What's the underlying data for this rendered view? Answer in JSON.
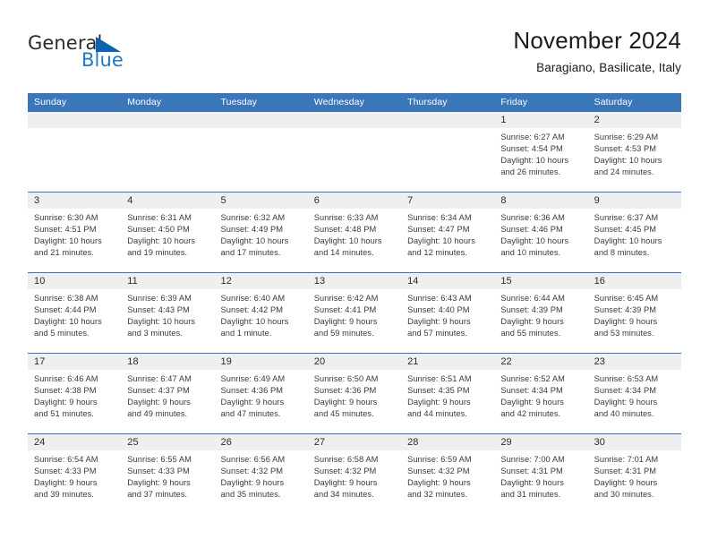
{
  "logo": {
    "word_one": "General",
    "word_two": "Blue",
    "triangle_color": "#0b62ad",
    "blue_text_color": "#1f7ac9"
  },
  "header": {
    "title": "November 2024",
    "subtitle": "Baragiano, Basilicate, Italy"
  },
  "theme": {
    "header_blue": "#3a77b9",
    "daynum_gray": "#efeff0",
    "text_dark": "#2b2b2b",
    "body_text": "#3a3a3a"
  },
  "weekdays": [
    "Sunday",
    "Monday",
    "Tuesday",
    "Wednesday",
    "Thursday",
    "Friday",
    "Saturday"
  ],
  "weeks": [
    [
      {
        "day": "",
        "empty": true
      },
      {
        "day": "",
        "empty": true
      },
      {
        "day": "",
        "empty": true
      },
      {
        "day": "",
        "empty": true
      },
      {
        "day": "",
        "empty": true
      },
      {
        "day": "1",
        "sunrise": "Sunrise: 6:27 AM",
        "sunset": "Sunset: 4:54 PM",
        "daylight_1": "Daylight: 10 hours",
        "daylight_2": "and 26 minutes."
      },
      {
        "day": "2",
        "sunrise": "Sunrise: 6:29 AM",
        "sunset": "Sunset: 4:53 PM",
        "daylight_1": "Daylight: 10 hours",
        "daylight_2": "and 24 minutes."
      }
    ],
    [
      {
        "day": "3",
        "sunrise": "Sunrise: 6:30 AM",
        "sunset": "Sunset: 4:51 PM",
        "daylight_1": "Daylight: 10 hours",
        "daylight_2": "and 21 minutes."
      },
      {
        "day": "4",
        "sunrise": "Sunrise: 6:31 AM",
        "sunset": "Sunset: 4:50 PM",
        "daylight_1": "Daylight: 10 hours",
        "daylight_2": "and 19 minutes."
      },
      {
        "day": "5",
        "sunrise": "Sunrise: 6:32 AM",
        "sunset": "Sunset: 4:49 PM",
        "daylight_1": "Daylight: 10 hours",
        "daylight_2": "and 17 minutes."
      },
      {
        "day": "6",
        "sunrise": "Sunrise: 6:33 AM",
        "sunset": "Sunset: 4:48 PM",
        "daylight_1": "Daylight: 10 hours",
        "daylight_2": "and 14 minutes."
      },
      {
        "day": "7",
        "sunrise": "Sunrise: 6:34 AM",
        "sunset": "Sunset: 4:47 PM",
        "daylight_1": "Daylight: 10 hours",
        "daylight_2": "and 12 minutes."
      },
      {
        "day": "8",
        "sunrise": "Sunrise: 6:36 AM",
        "sunset": "Sunset: 4:46 PM",
        "daylight_1": "Daylight: 10 hours",
        "daylight_2": "and 10 minutes."
      },
      {
        "day": "9",
        "sunrise": "Sunrise: 6:37 AM",
        "sunset": "Sunset: 4:45 PM",
        "daylight_1": "Daylight: 10 hours",
        "daylight_2": "and 8 minutes."
      }
    ],
    [
      {
        "day": "10",
        "sunrise": "Sunrise: 6:38 AM",
        "sunset": "Sunset: 4:44 PM",
        "daylight_1": "Daylight: 10 hours",
        "daylight_2": "and 5 minutes."
      },
      {
        "day": "11",
        "sunrise": "Sunrise: 6:39 AM",
        "sunset": "Sunset: 4:43 PM",
        "daylight_1": "Daylight: 10 hours",
        "daylight_2": "and 3 minutes."
      },
      {
        "day": "12",
        "sunrise": "Sunrise: 6:40 AM",
        "sunset": "Sunset: 4:42 PM",
        "daylight_1": "Daylight: 10 hours",
        "daylight_2": "and 1 minute."
      },
      {
        "day": "13",
        "sunrise": "Sunrise: 6:42 AM",
        "sunset": "Sunset: 4:41 PM",
        "daylight_1": "Daylight: 9 hours",
        "daylight_2": "and 59 minutes."
      },
      {
        "day": "14",
        "sunrise": "Sunrise: 6:43 AM",
        "sunset": "Sunset: 4:40 PM",
        "daylight_1": "Daylight: 9 hours",
        "daylight_2": "and 57 minutes."
      },
      {
        "day": "15",
        "sunrise": "Sunrise: 6:44 AM",
        "sunset": "Sunset: 4:39 PM",
        "daylight_1": "Daylight: 9 hours",
        "daylight_2": "and 55 minutes."
      },
      {
        "day": "16",
        "sunrise": "Sunrise: 6:45 AM",
        "sunset": "Sunset: 4:39 PM",
        "daylight_1": "Daylight: 9 hours",
        "daylight_2": "and 53 minutes."
      }
    ],
    [
      {
        "day": "17",
        "sunrise": "Sunrise: 6:46 AM",
        "sunset": "Sunset: 4:38 PM",
        "daylight_1": "Daylight: 9 hours",
        "daylight_2": "and 51 minutes."
      },
      {
        "day": "18",
        "sunrise": "Sunrise: 6:47 AM",
        "sunset": "Sunset: 4:37 PM",
        "daylight_1": "Daylight: 9 hours",
        "daylight_2": "and 49 minutes."
      },
      {
        "day": "19",
        "sunrise": "Sunrise: 6:49 AM",
        "sunset": "Sunset: 4:36 PM",
        "daylight_1": "Daylight: 9 hours",
        "daylight_2": "and 47 minutes."
      },
      {
        "day": "20",
        "sunrise": "Sunrise: 6:50 AM",
        "sunset": "Sunset: 4:36 PM",
        "daylight_1": "Daylight: 9 hours",
        "daylight_2": "and 45 minutes."
      },
      {
        "day": "21",
        "sunrise": "Sunrise: 6:51 AM",
        "sunset": "Sunset: 4:35 PM",
        "daylight_1": "Daylight: 9 hours",
        "daylight_2": "and 44 minutes."
      },
      {
        "day": "22",
        "sunrise": "Sunrise: 6:52 AM",
        "sunset": "Sunset: 4:34 PM",
        "daylight_1": "Daylight: 9 hours",
        "daylight_2": "and 42 minutes."
      },
      {
        "day": "23",
        "sunrise": "Sunrise: 6:53 AM",
        "sunset": "Sunset: 4:34 PM",
        "daylight_1": "Daylight: 9 hours",
        "daylight_2": "and 40 minutes."
      }
    ],
    [
      {
        "day": "24",
        "sunrise": "Sunrise: 6:54 AM",
        "sunset": "Sunset: 4:33 PM",
        "daylight_1": "Daylight: 9 hours",
        "daylight_2": "and 39 minutes."
      },
      {
        "day": "25",
        "sunrise": "Sunrise: 6:55 AM",
        "sunset": "Sunset: 4:33 PM",
        "daylight_1": "Daylight: 9 hours",
        "daylight_2": "and 37 minutes."
      },
      {
        "day": "26",
        "sunrise": "Sunrise: 6:56 AM",
        "sunset": "Sunset: 4:32 PM",
        "daylight_1": "Daylight: 9 hours",
        "daylight_2": "and 35 minutes."
      },
      {
        "day": "27",
        "sunrise": "Sunrise: 6:58 AM",
        "sunset": "Sunset: 4:32 PM",
        "daylight_1": "Daylight: 9 hours",
        "daylight_2": "and 34 minutes."
      },
      {
        "day": "28",
        "sunrise": "Sunrise: 6:59 AM",
        "sunset": "Sunset: 4:32 PM",
        "daylight_1": "Daylight: 9 hours",
        "daylight_2": "and 32 minutes."
      },
      {
        "day": "29",
        "sunrise": "Sunrise: 7:00 AM",
        "sunset": "Sunset: 4:31 PM",
        "daylight_1": "Daylight: 9 hours",
        "daylight_2": "and 31 minutes."
      },
      {
        "day": "30",
        "sunrise": "Sunrise: 7:01 AM",
        "sunset": "Sunset: 4:31 PM",
        "daylight_1": "Daylight: 9 hours",
        "daylight_2": "and 30 minutes."
      }
    ]
  ]
}
